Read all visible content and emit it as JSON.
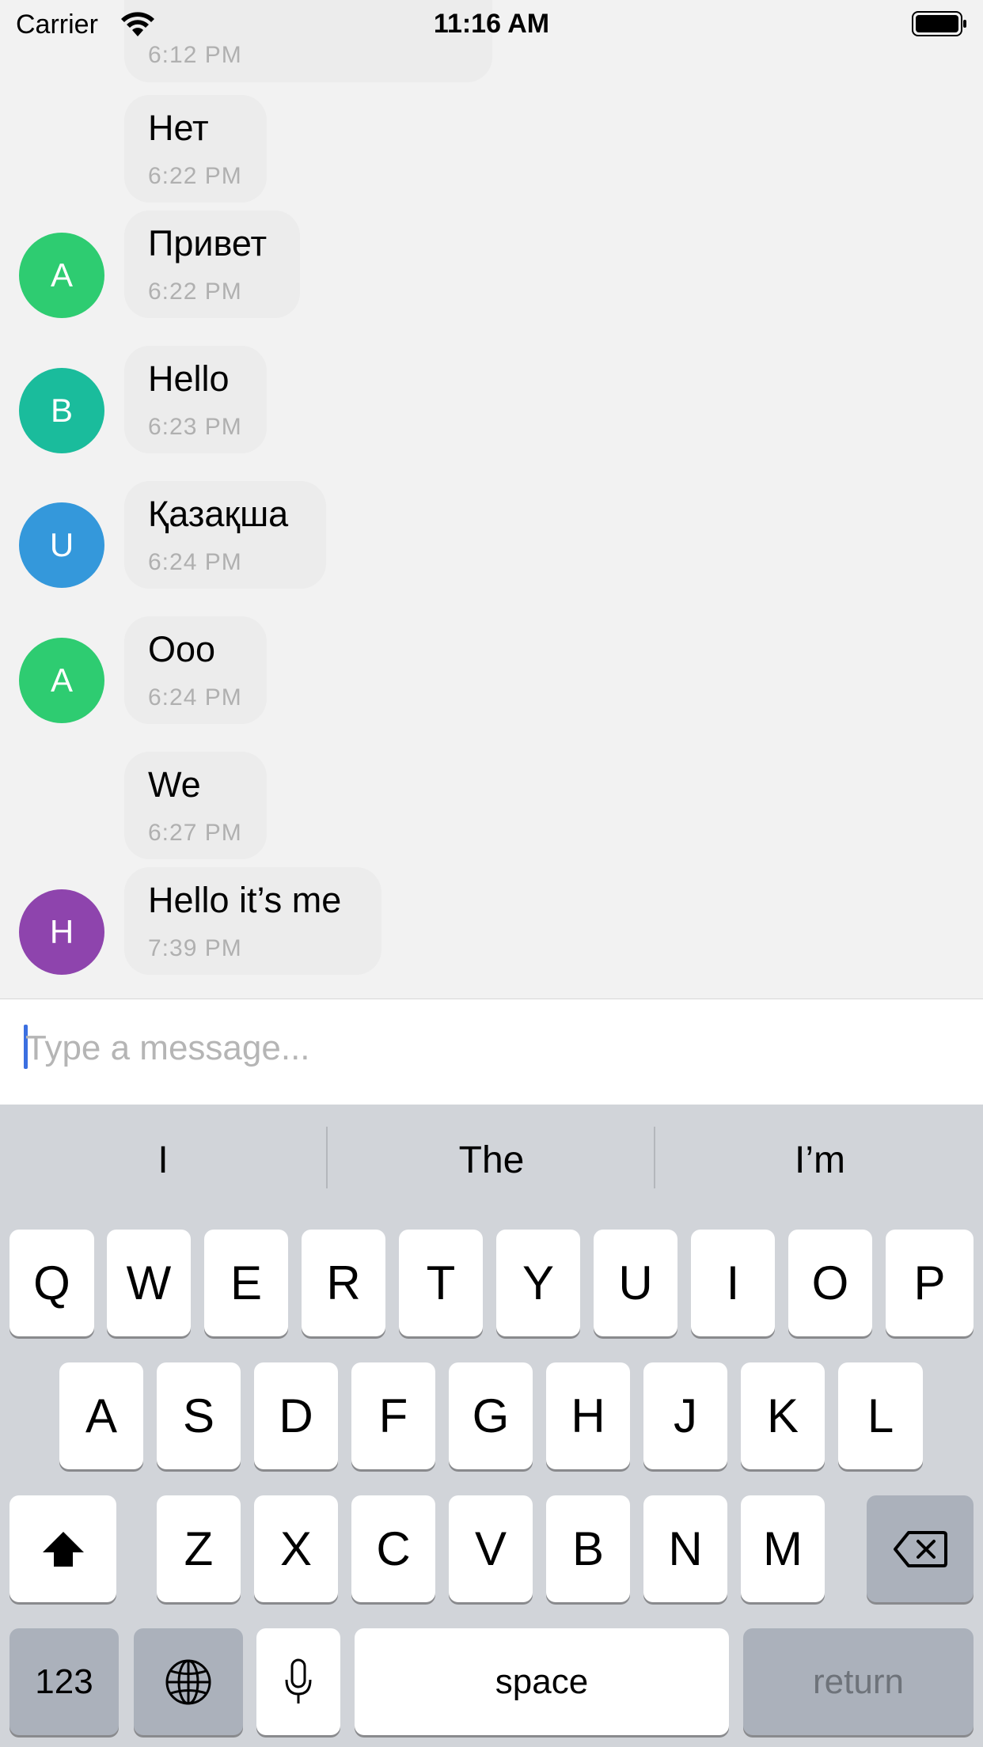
{
  "status_bar": {
    "carrier": "Carrier",
    "time": "11:16 AM",
    "icons": [
      "wifi-icon",
      "battery-icon"
    ]
  },
  "messages": [
    {
      "text": "",
      "time": "6:12 PM",
      "avatar": null
    },
    {
      "text": "Нет",
      "time": "6:22 PM",
      "avatar": null
    },
    {
      "text": "Привет",
      "time": "6:22 PM",
      "avatar": {
        "letter": "A",
        "color": "#2ecc71"
      }
    },
    {
      "text": "Hello",
      "time": "6:23 PM",
      "avatar": {
        "letter": "B",
        "color": "#1abc9c"
      }
    },
    {
      "text": "Қазақша",
      "time": "6:24 PM",
      "avatar": {
        "letter": "U",
        "color": "#3498db"
      }
    },
    {
      "text": "Ooo",
      "time": "6:24 PM",
      "avatar": {
        "letter": "A",
        "color": "#2ecc71"
      }
    },
    {
      "text": "We",
      "time": "6:27 PM",
      "avatar": null
    },
    {
      "text": "Hello it’s me",
      "time": "7:39 PM",
      "avatar": {
        "letter": "H",
        "color": "#8e44ad"
      }
    }
  ],
  "composer": {
    "placeholder": "Type a message..."
  },
  "keyboard": {
    "suggestions": [
      "I",
      "The",
      "I’m"
    ],
    "row1": [
      "Q",
      "W",
      "E",
      "R",
      "T",
      "Y",
      "U",
      "I",
      "O",
      "P"
    ],
    "row2": [
      "A",
      "S",
      "D",
      "F",
      "G",
      "H",
      "J",
      "K",
      "L"
    ],
    "row3": [
      "Z",
      "X",
      "C",
      "V",
      "B",
      "N",
      "M"
    ],
    "numbers_label": "123",
    "space_label": "space",
    "return_label": "return"
  },
  "colors": {
    "background": "#f2f2f2",
    "bubble": "#ececec",
    "keyboard_bg": "#d1d4d9",
    "cursor": "#3b6fe0"
  }
}
